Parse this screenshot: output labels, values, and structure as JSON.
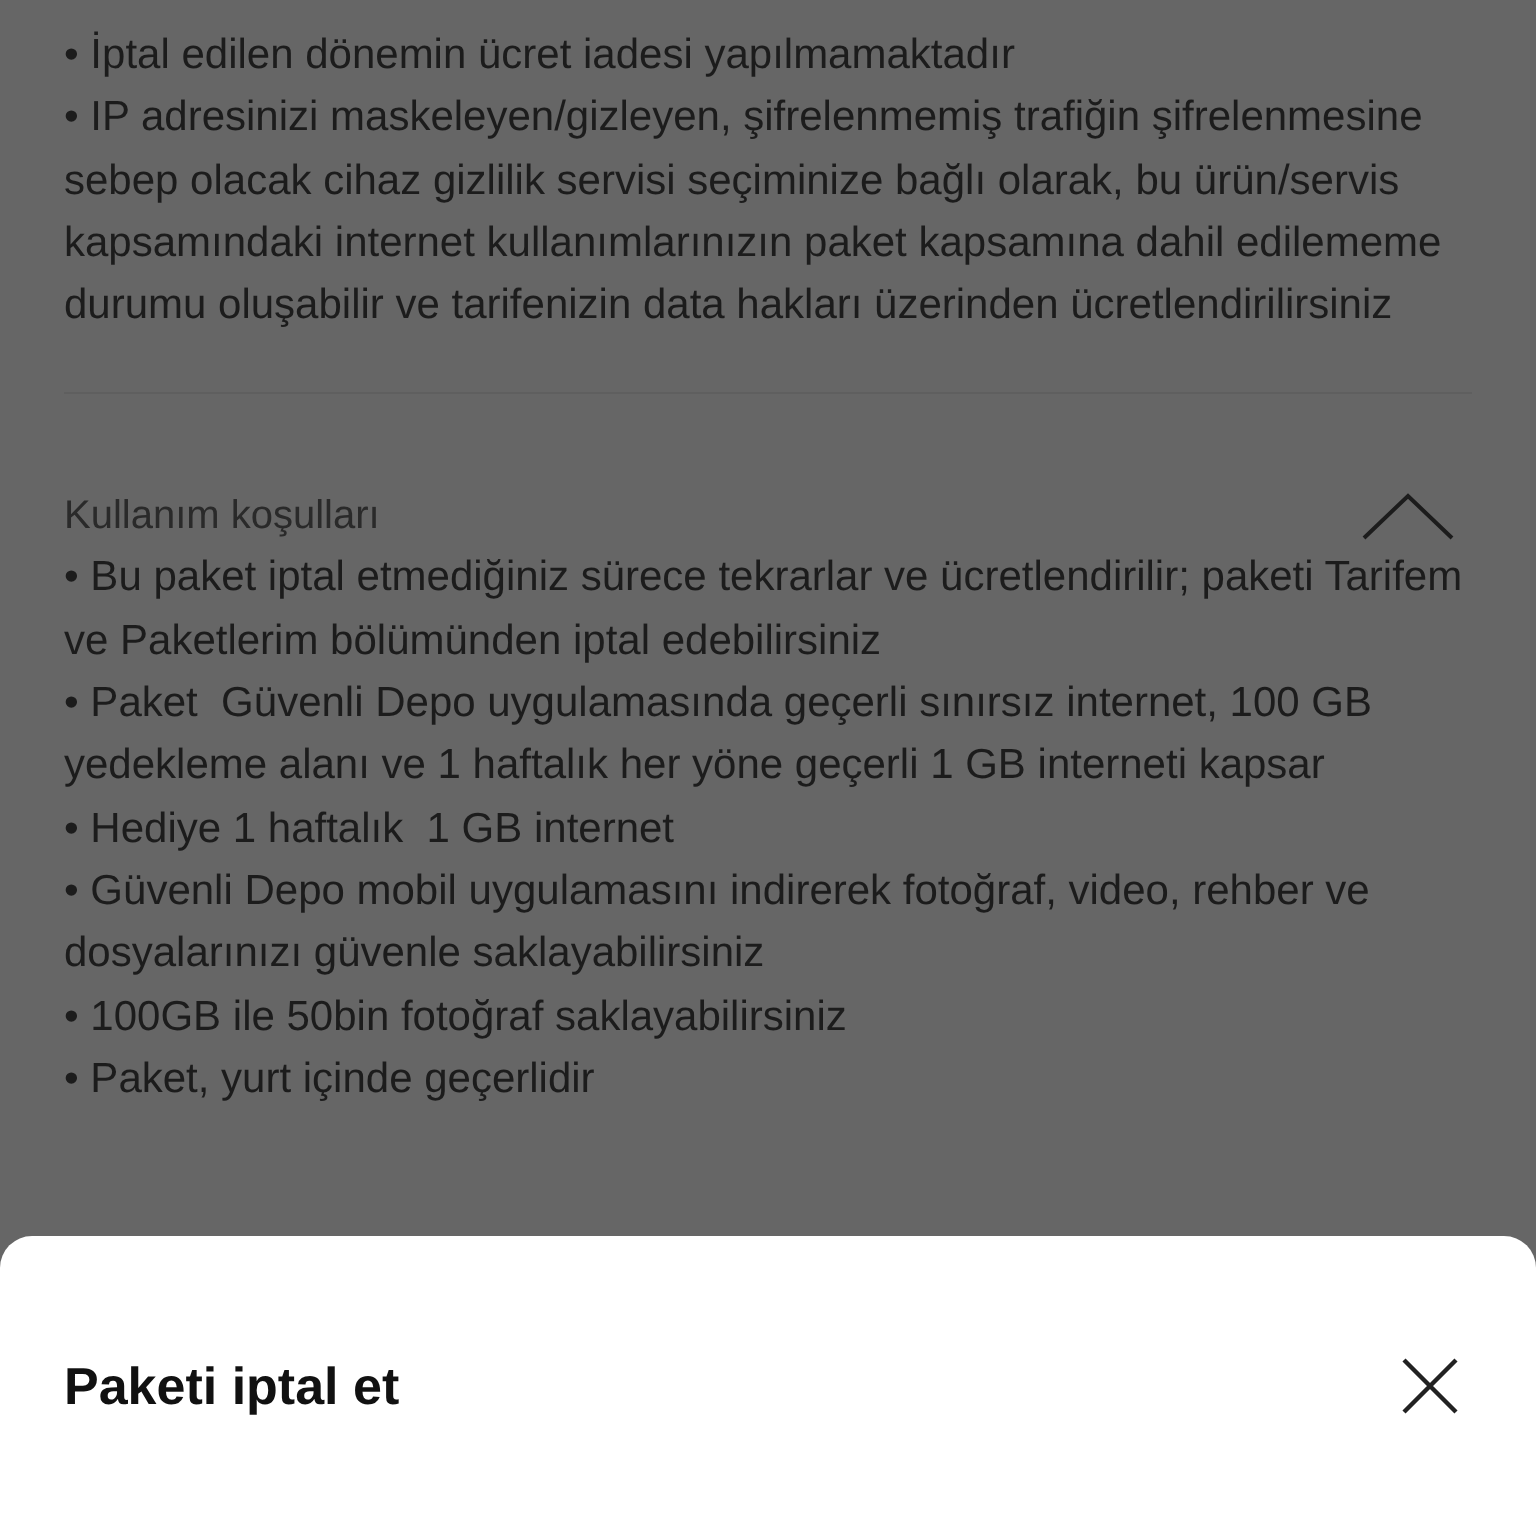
{
  "top_section": {
    "items": [
      "• İptal edilen dönemin ücret iadesi yapılmamaktadır",
      "• IP adresinizi maskeleyen/gizleyen, şifrelenmemiş trafiğin şifrelenmesine sebep olacak cihaz gizlilik servisi seçiminize bağlı olarak, bu ürün/servis kapsamındaki internet kullanımlarınızın paket kapsamına dahil edilememe durumu oluşabilir ve tarifenizin data hakları üzerinden ücretlendirilirsiniz"
    ]
  },
  "terms_section": {
    "title": "Kullanım koşulları",
    "expanded": true,
    "items": [
      "• Bu paket iptal etmediğiniz sürece tekrarlar ve ücretlendirilir; paketi Tarifem ve Paketlerim bölümünden iptal edebilirsiniz",
      "• Paket  Güvenli Depo uygulamasında geçerli sınırsız internet, 100 GB yedekleme alanı ve 1 haftalık her yöne geçerli 1 GB interneti kapsar",
      "• Hediye 1 haftalık  1 GB internet",
      "• Güvenli Depo mobil uygulamasını indirerek fotoğraf, video, rehber ve dosyalarınızı güvenle saklayabilirsiniz",
      "• 100GB ile 50bin fotoğraf saklayabilirsiniz",
      "• Paket, yurt içinde geçerlidir"
    ]
  },
  "sheet": {
    "title": "Paketi iptal et"
  }
}
